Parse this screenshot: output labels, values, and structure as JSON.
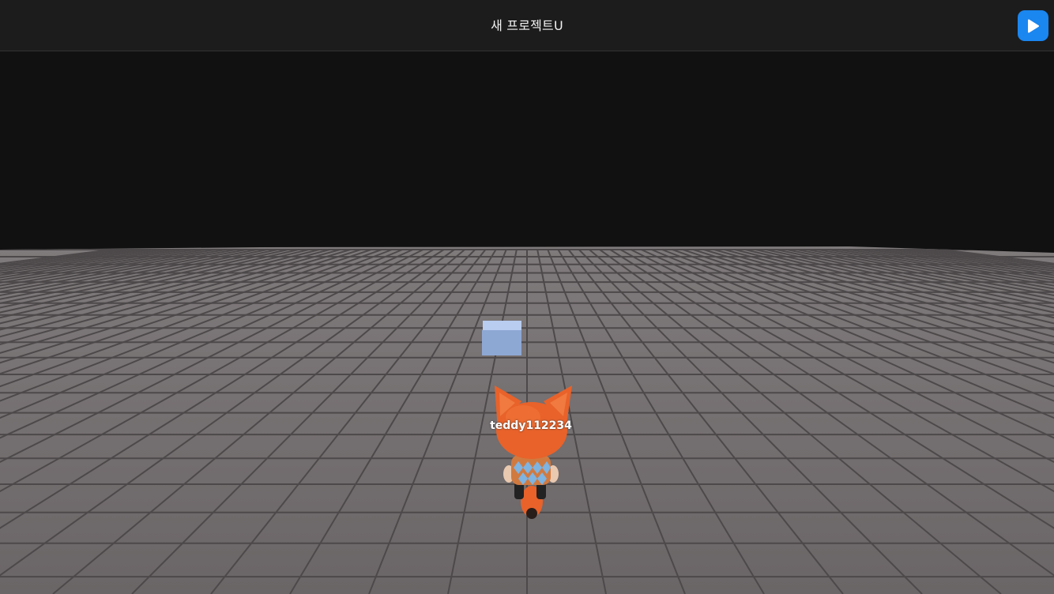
{
  "header": {
    "title": "새 프로젝트U",
    "play_icon": "play-icon"
  },
  "scene": {
    "player_name": "teddy112234",
    "floor_color": "#6f6a6b",
    "tile_line_color": "#4a4647",
    "sky_color": "#111111",
    "cube_color": "#8fa9d6",
    "character": "fox-avatar",
    "accent": "#1a86f0"
  }
}
